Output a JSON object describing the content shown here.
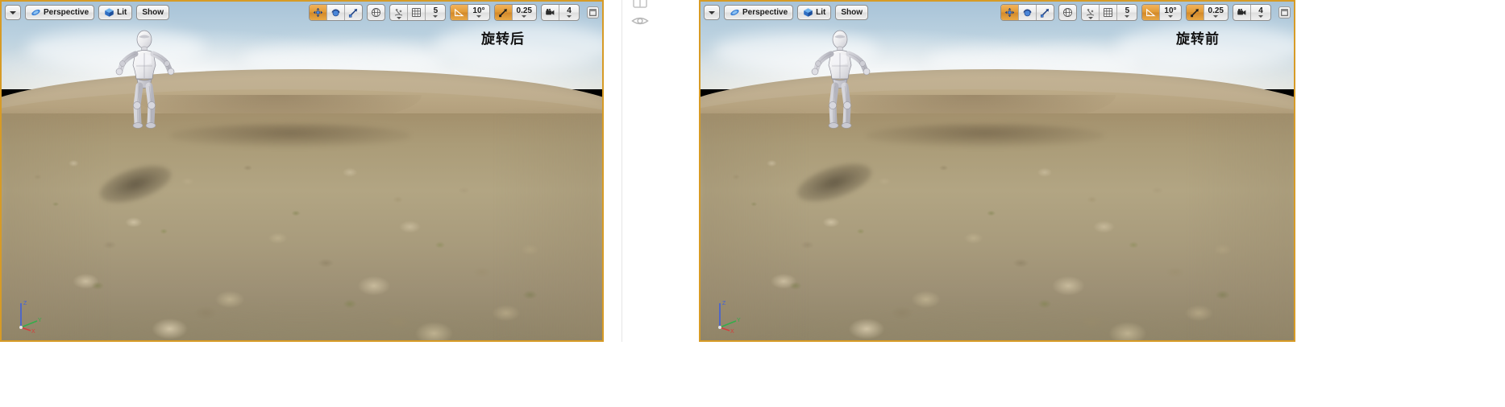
{
  "app": {
    "editor": "Unreal Engine Level Editor",
    "layout": "dual-viewport-comparison"
  },
  "viewports": [
    {
      "id": "viewport-left",
      "annotation": "旋转后",
      "toolbar": {
        "options_caret": "▾",
        "view_mode_label": "Perspective",
        "view_mode_icon": "perspective-camera-icon",
        "lighting_label": "Lit",
        "lighting_icon": "lit-cube-icon",
        "show_label": "Show",
        "transform_tools": [
          {
            "name": "translate-mode",
            "icon": "move-arrows-icon",
            "active": true
          },
          {
            "name": "rotate-mode",
            "icon": "rotate-sphere-icon",
            "active": false
          },
          {
            "name": "scale-mode",
            "icon": "scale-arrow-icon",
            "active": false
          }
        ],
        "coordinate_system": {
          "icon": "world-globe-icon",
          "label": "World"
        },
        "surface_snap": {
          "icon": "surface-snap-icon",
          "active": false
        },
        "grid_snap": {
          "icon": "grid-icon",
          "active": false,
          "value": "5"
        },
        "rotation_snap": {
          "icon": "angle-triangle-icon",
          "active": true,
          "value": "10°"
        },
        "scale_snap": {
          "icon": "scale-snap-icon",
          "active": true,
          "value": "0.25"
        },
        "camera_speed": {
          "icon": "camera-icon",
          "value": "4"
        },
        "maximize": {
          "icon": "maximize-viewport-icon"
        }
      },
      "scene": {
        "character": "white-mannequin",
        "environment": "rocky-desert-terrain",
        "axis_gizmo": {
          "x": "X",
          "y": "Y",
          "z": "Z"
        }
      }
    },
    {
      "id": "viewport-right",
      "annotation": "旋转前",
      "toolbar": {
        "options_caret": "▾",
        "view_mode_label": "Perspective",
        "view_mode_icon": "perspective-camera-icon",
        "lighting_label": "Lit",
        "lighting_icon": "lit-cube-icon",
        "show_label": "Show",
        "transform_tools": [
          {
            "name": "translate-mode",
            "icon": "move-arrows-icon",
            "active": true
          },
          {
            "name": "rotate-mode",
            "icon": "rotate-sphere-icon",
            "active": false
          },
          {
            "name": "scale-mode",
            "icon": "scale-arrow-icon",
            "active": false
          }
        ],
        "coordinate_system": {
          "icon": "world-globe-icon",
          "label": "World"
        },
        "surface_snap": {
          "icon": "surface-snap-icon",
          "active": false
        },
        "grid_snap": {
          "icon": "grid-icon",
          "active": false,
          "value": "5"
        },
        "rotation_snap": {
          "icon": "angle-triangle-icon",
          "active": true,
          "value": "10°"
        },
        "scale_snap": {
          "icon": "scale-snap-icon",
          "active": true,
          "value": "0.25"
        },
        "camera_speed": {
          "icon": "camera-icon",
          "value": "4"
        },
        "maximize": {
          "icon": "maximize-viewport-icon"
        }
      },
      "scene": {
        "character": "white-mannequin",
        "environment": "rocky-desert-terrain",
        "axis_gizmo": {
          "x": "X",
          "y": "Y",
          "z": "Z"
        }
      }
    }
  ],
  "gutter": {
    "icons": [
      {
        "name": "panel-layout-icon"
      },
      {
        "name": "eye-visibility-icon"
      }
    ]
  },
  "colors": {
    "viewport_border": "#d79b26",
    "toolbar_active": "#e09b36",
    "page_background": "#ffffff"
  }
}
